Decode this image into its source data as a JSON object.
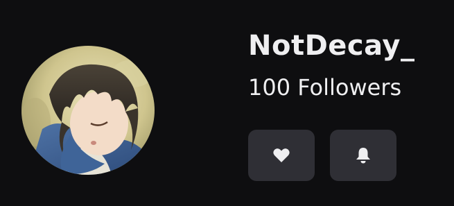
{
  "profile": {
    "username": "NotDecay_",
    "followers_text": "100 Followers",
    "avatar_icon": "anime-character-avatar"
  },
  "actions": {
    "follow_icon": "heart-icon",
    "notify_icon": "bell-icon"
  },
  "colors": {
    "background": "#0e0e10",
    "text": "#efeff1",
    "button_bg": "#2f2f35"
  }
}
